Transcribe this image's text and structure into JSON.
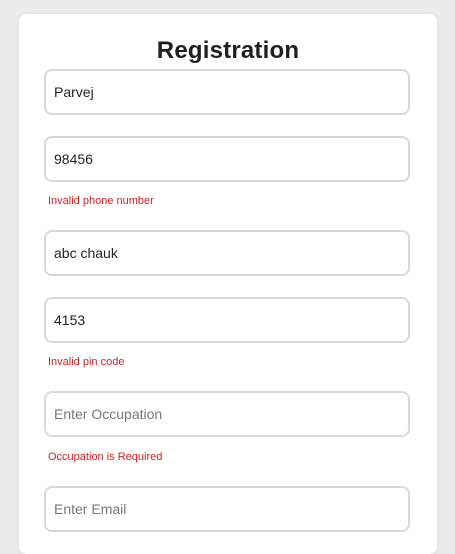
{
  "form": {
    "title": "Registration",
    "fields": [
      {
        "name": "name",
        "value": "Parvej",
        "placeholder": "",
        "error": ""
      },
      {
        "name": "phone",
        "value": "98456",
        "placeholder": "",
        "error": "Invalid phone number"
      },
      {
        "name": "address",
        "value": "abc chauk",
        "placeholder": "",
        "error": ""
      },
      {
        "name": "pincode",
        "value": "4153",
        "placeholder": "",
        "error": "Invalid pin code"
      },
      {
        "name": "occupation",
        "value": "",
        "placeholder": "Enter Occupation",
        "error": "Occupation is Required"
      },
      {
        "name": "email",
        "value": "",
        "placeholder": "Enter Email",
        "error": ""
      }
    ]
  },
  "colors": {
    "error": "#d32020",
    "border": "#d9d9d9",
    "background": "#ececec"
  }
}
